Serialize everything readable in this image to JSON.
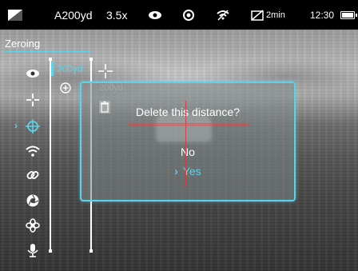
{
  "status_bar": {
    "profile": "A200yd",
    "zoom": "3.5x",
    "timer": "2min",
    "time": "12:30",
    "icons": [
      "image-mode-icon",
      "eye-icon",
      "shutter-icon",
      "wifi-off-icon",
      "display-off-timer-icon",
      "battery-icon"
    ]
  },
  "menu": {
    "title": "Zeroing",
    "items": [
      {
        "name": "eye-icon"
      },
      {
        "name": "crosshair-icon"
      },
      {
        "name": "target-reticle-icon",
        "selected": true
      },
      {
        "name": "wifi-icon"
      },
      {
        "name": "link-icon"
      },
      {
        "name": "shutter-icon"
      },
      {
        "name": "fan-icon"
      },
      {
        "name": "microphone-icon"
      }
    ],
    "selected_arrow": "›"
  },
  "distances": {
    "selected": "200yd",
    "faded": "200yd"
  },
  "dialog": {
    "question": "Delete this distance?",
    "options": [
      "No",
      "Yes"
    ],
    "selected_option": "Yes",
    "arrow": "›"
  },
  "colors": {
    "accent": "#5fd2e8",
    "reticle": "#dc3c3c"
  }
}
